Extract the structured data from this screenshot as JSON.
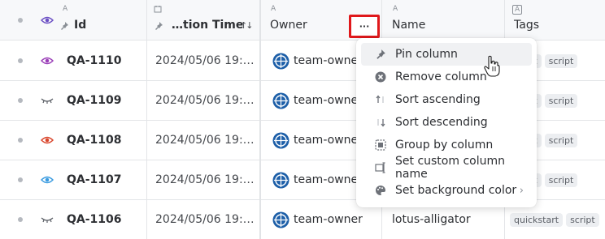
{
  "columns": {
    "id": {
      "type_icon": "A",
      "label": "Id"
    },
    "time": {
      "label": "…tion Time",
      "sort_indicator": "↑↓"
    },
    "owner": {
      "type_icon": "A",
      "label": "Owner",
      "menu_button": "···"
    },
    "name": {
      "type_icon": "A",
      "label": "Name"
    },
    "tags": {
      "type_icon": "A",
      "label": "Tags"
    }
  },
  "rows": [
    {
      "eye": "eye-purple",
      "id": "QA-1110",
      "time": "2024/05/06 19:…",
      "owner": "team-owner",
      "name": "",
      "tags": [
        "start",
        "script"
      ]
    },
    {
      "eye": "eye-closed",
      "id": "QA-1109",
      "time": "2024/05/06 19:…",
      "owner": "team-owner",
      "name": "",
      "tags": [
        "start",
        "script"
      ]
    },
    {
      "eye": "eye-red",
      "id": "QA-1108",
      "time": "2024/05/06 19:…",
      "owner": "team-owner",
      "name": "",
      "tags": [
        "start",
        "script"
      ]
    },
    {
      "eye": "eye-blue",
      "id": "QA-1107",
      "time": "2024/05/06 19:…",
      "owner": "team-owner",
      "name": "",
      "tags": [
        "start",
        "script"
      ]
    },
    {
      "eye": "eye-closed",
      "id": "QA-1106",
      "time": "2024/05/06 19:…",
      "owner": "team-owner",
      "name": "lotus-alligator",
      "tags": [
        "quickstart",
        "script"
      ]
    }
  ],
  "menu": {
    "items": [
      {
        "label": "Pin column",
        "icon": "pin-icon"
      },
      {
        "label": "Remove column",
        "icon": "remove-circle-icon"
      },
      {
        "label": "Sort ascending",
        "icon": "sort-ascending-icon"
      },
      {
        "label": "Sort descending",
        "icon": "sort-descending-icon"
      },
      {
        "label": "Group by column",
        "icon": "group-icon"
      },
      {
        "label": "Set custom column name",
        "icon": "rename-icon"
      },
      {
        "label": "Set background color",
        "icon": "palette-icon",
        "submenu": "›"
      }
    ]
  },
  "colors": {
    "highlight_box": "#e0181b",
    "owner_icon": "#1d5fa8",
    "eye_purple": "#9b3fb8",
    "eye_red": "#d9452b",
    "eye_blue": "#3a9be0",
    "eye_header": "#6b4fc4"
  }
}
